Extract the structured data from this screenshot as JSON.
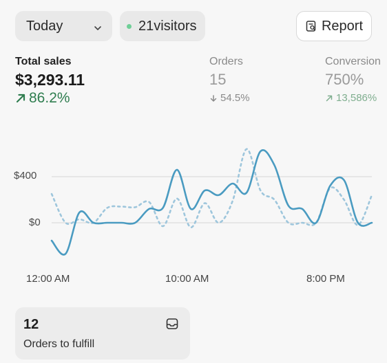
{
  "header": {
    "date_selected": "Today",
    "visitors_label": "21visitors",
    "report_label": "Report"
  },
  "metrics": {
    "total_sales": {
      "label": "Total sales",
      "value": "$3,293.11",
      "delta": "86.2%"
    },
    "orders": {
      "label": "Orders",
      "value": "15",
      "delta": "54.5%"
    },
    "conversion": {
      "label": "Conversion",
      "value": "750%",
      "delta": "13,586%"
    }
  },
  "chart_data": {
    "type": "line",
    "y_ticks": [
      "$400",
      "$0"
    ],
    "x_ticks": [
      "12:00 AM",
      "10:00 AM",
      "8:00 PM"
    ],
    "colors": {
      "current": "#4a9bc1",
      "comparison": "#9ec6dc"
    },
    "series": [
      {
        "values": [
          -155,
          -270,
          90,
          0,
          0,
          0,
          0,
          120,
          130,
          460,
          120,
          280,
          240,
          340,
          260,
          620,
          500,
          150,
          120,
          0,
          320,
          370,
          0,
          0
        ]
      },
      {
        "values": [
          250,
          0,
          30,
          0,
          130,
          140,
          135,
          180,
          -30,
          210,
          -40,
          170,
          0,
          190,
          640,
          280,
          200,
          0,
          0,
          0,
          300,
          200,
          -20,
          240
        ]
      }
    ],
    "ylim": [
      -350,
      700
    ]
  },
  "fulfill_card": {
    "count": "12",
    "label": "Orders to fulfill"
  }
}
